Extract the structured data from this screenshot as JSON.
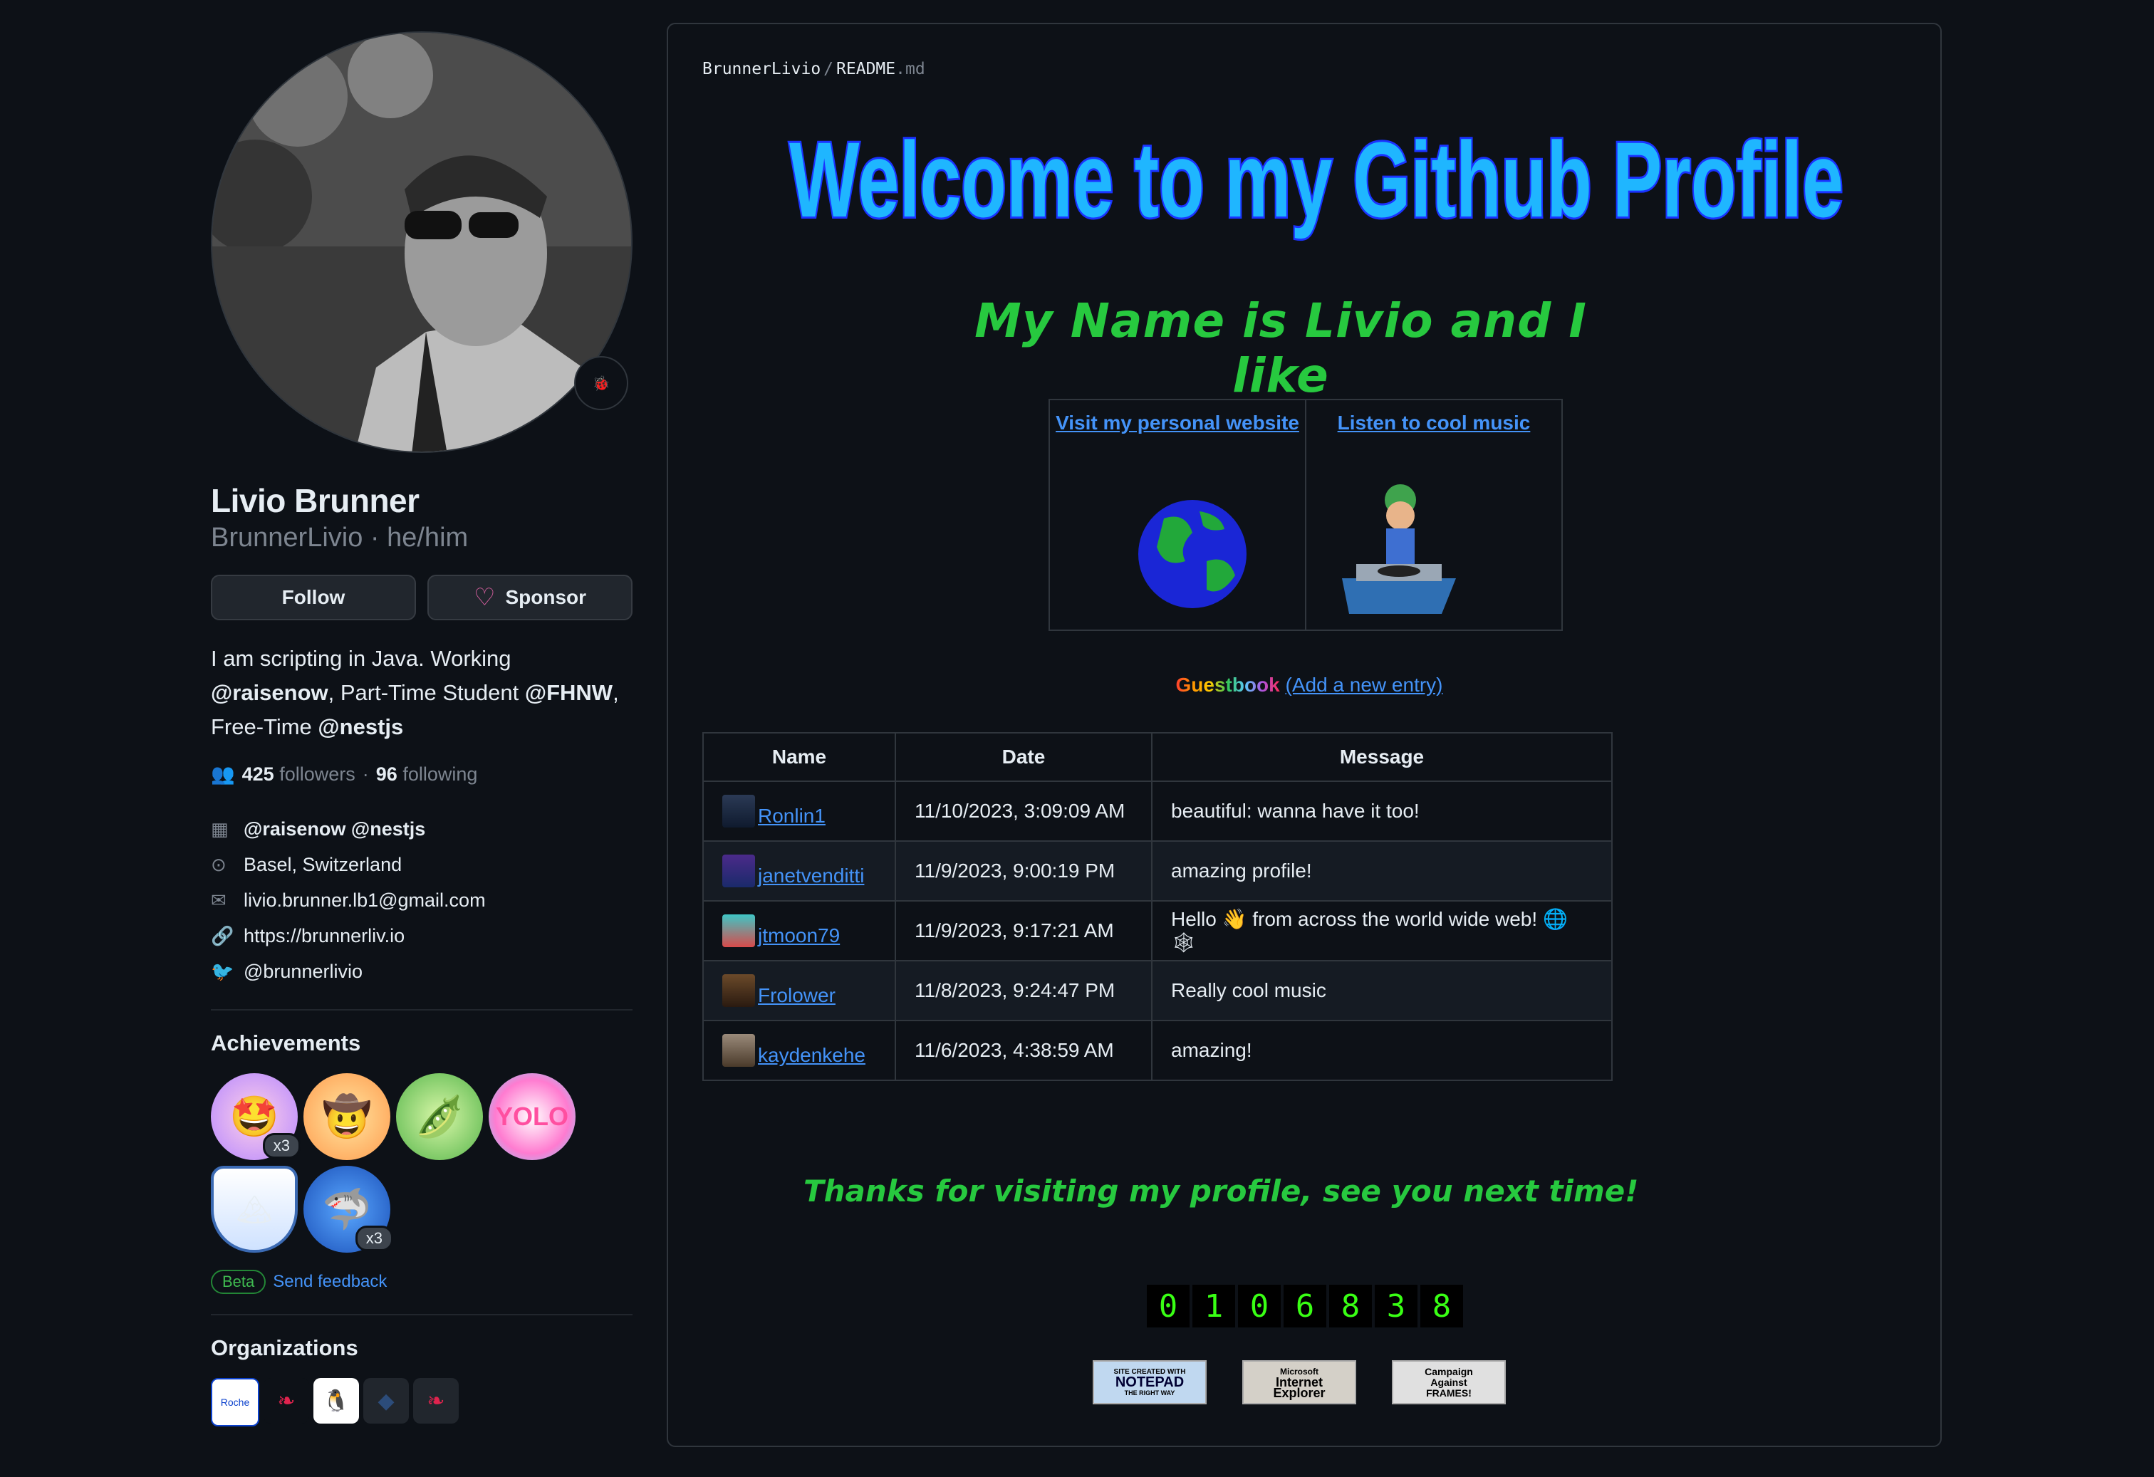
{
  "profile": {
    "display_name": "Livio Brunner",
    "login_line": "BrunnerLivio · he/him",
    "status_icon": "ladybug-icon",
    "follow_label": "Follow",
    "sponsor_label": "Sponsor",
    "bio_line1": "I am scripting in Java. Working",
    "bio_org1": "@raisenow",
    "bio_mid": ", Part-Time Student ",
    "bio_org2": "@FHNW",
    "bio_comma": ",",
    "bio_line3": "Free-Time ",
    "bio_org3": "@nestjs",
    "followers_count": "425",
    "followers_label": "followers",
    "dot": "·",
    "following_count": "96",
    "following_label": "following",
    "company": "@raisenow @nestjs",
    "location": "Basel, Switzerland",
    "email": "livio.brunner.lb1@gmail.com",
    "website": "https://brunnerliv.io",
    "twitter": "@brunnerlivio"
  },
  "achievements": {
    "title": "Achievements",
    "badge1_count": "x3",
    "badge6_count": "x3",
    "beta_label": "Beta",
    "feedback_label": "Send feedback"
  },
  "organizations": {
    "title": "Organizations",
    "items": [
      "Roche",
      "nestjs",
      "penguin",
      "org-dark",
      "nestjs-alt"
    ]
  },
  "readme": {
    "crumb_owner": "BrunnerLivio",
    "crumb_sep": "/",
    "crumb_file": "README",
    "crumb_ext": ".md",
    "welcome_text": "Welcome to my Github Profile",
    "intro_text": "My Name is Livio and I like",
    "link_website": "Visit my personal website",
    "link_music": "Listen to cool music",
    "guestbook_title": "Guestbook",
    "guestbook_add": "(Add a new entry)",
    "columns": [
      "Name",
      "Date",
      "Message"
    ],
    "entries": [
      {
        "name": "Ronlin1",
        "date": "11/10/2023, 3:09:09 AM",
        "message": "beautiful: wanna have it too!"
      },
      {
        "name": "janetvenditti",
        "date": "11/9/2023, 9:00:19 PM",
        "message": "amazing profile!"
      },
      {
        "name": "jtmoon79",
        "date": "11/9/2023, 9:17:21 AM",
        "message": "Hello 👋 from across the world wide web! 🌐🕸"
      },
      {
        "name": "Frolower",
        "date": "11/8/2023, 9:24:47 PM",
        "message": "Really cool music"
      },
      {
        "name": "kaydenkehe",
        "date": "11/6/2023, 4:38:59 AM",
        "message": "amazing!"
      }
    ],
    "thanks_text": "Thanks for visiting my profile, see you next time!",
    "counter_digits": [
      "0",
      "1",
      "0",
      "6",
      "8",
      "3",
      "8"
    ],
    "badge_notepad_1": "SITE CREATED WITH",
    "badge_notepad_2": "NOTEPAD",
    "badge_notepad_3": "THE RIGHT WAY",
    "badge_ie_1": "Microsoft",
    "badge_ie_2": "Internet",
    "badge_ie_3": "Explorer",
    "badge_frames_1": "Campaign",
    "badge_frames_2": "Against",
    "badge_frames_3": "FRAMES!"
  },
  "colors": {
    "background": "#0d1117",
    "link": "#4493f8",
    "green_text": "#27c93f",
    "welcome_fill": "#1fb6ff",
    "welcome_outline": "#1a33ff"
  }
}
